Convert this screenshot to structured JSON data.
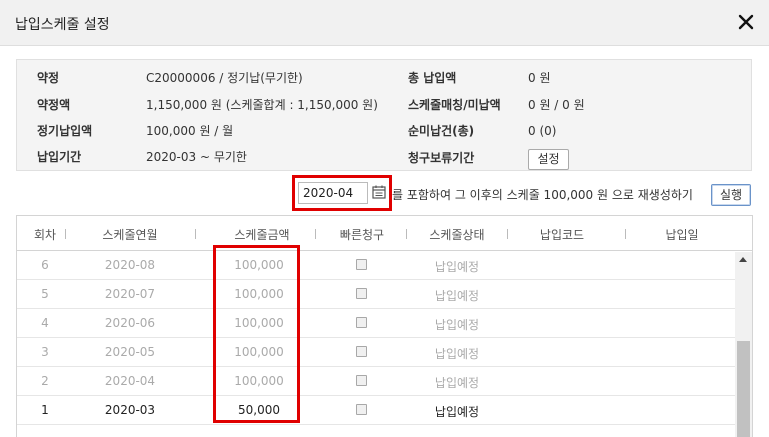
{
  "dialog": {
    "title": "납입스케줄 설정"
  },
  "info": {
    "contract_label": "약정",
    "contract_value": "C20000006 / 정기납(무기한)",
    "amount_label": "약정액",
    "amount_value": "1,150,000 원 (스케줄합계 : 1,150,000 원)",
    "regular_label": "정기납입액",
    "regular_value": "100,000 원 / 월",
    "period_label": "납입기간",
    "period_value": "2020-03 ~ 무기한",
    "total_label": "총 납입액",
    "total_value": "0 원",
    "matching_label": "스케줄매칭/미납액",
    "matching_value": "0 원 / 0 원",
    "unpaid_label": "순미납건(총)",
    "unpaid_value": "0 (0)",
    "hold_label": "청구보류기간",
    "hold_button": "설정"
  },
  "regen": {
    "date_value": "2020-04",
    "text": "를 포함하여 그 이후의 스케줄 100,000 원 으로 재생성하기",
    "run_button": "실행"
  },
  "table": {
    "headers": [
      "회차",
      "스케줄연월",
      "스케줄금액",
      "빠른청구",
      "스케줄상태",
      "납입코드",
      "납입일"
    ],
    "rows": [
      {
        "no": "6",
        "month": "2020-08",
        "amount": "100,000",
        "status": "납입예정"
      },
      {
        "no": "5",
        "month": "2020-07",
        "amount": "100,000",
        "status": "납입예정"
      },
      {
        "no": "4",
        "month": "2020-06",
        "amount": "100,000",
        "status": "납입예정"
      },
      {
        "no": "3",
        "month": "2020-05",
        "amount": "100,000",
        "status": "납입예정"
      },
      {
        "no": "2",
        "month": "2020-04",
        "amount": "100,000",
        "status": "납입예정"
      },
      {
        "no": "1",
        "month": "2020-03",
        "amount": "50,000",
        "status": "납입예정"
      }
    ]
  }
}
